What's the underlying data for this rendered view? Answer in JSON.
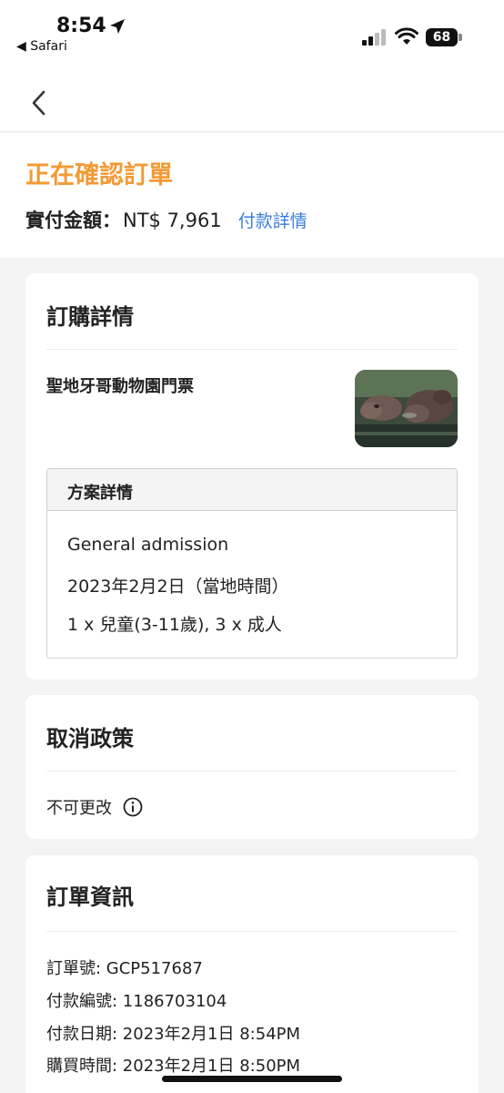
{
  "status_bar": {
    "time": "8:54",
    "back_app": "◀ Safari",
    "battery": "68"
  },
  "header": {
    "status_title": "正在確認訂單",
    "amount_label": "實付金額：",
    "amount_value": "NT$ 7,961",
    "payment_details_link": "付款詳情"
  },
  "booking": {
    "title": "訂購詳情",
    "product_name": "聖地牙哥動物園門票",
    "plan": {
      "header": "方案詳情",
      "name": "General admission",
      "date": "2023年2月2日（當地時間）",
      "quantity": "1 x 兒童(3-11歲), 3 x 成人"
    }
  },
  "cancellation": {
    "title": "取消政策",
    "policy": "不可更改"
  },
  "order_info": {
    "title": "訂單資訊",
    "order_no": "訂單號: GCP517687",
    "payment_no": "付款編號: 1186703104",
    "payment_date": "付款日期: 2023年2月1日 8:54PM",
    "purchase_time": "購買時間: 2023年2月1日 8:50PM"
  },
  "colors": {
    "accent_orange": "#f39a35",
    "link_blue": "#3a7ee0",
    "background": "#f3f3f3"
  },
  "icons": [
    "location-arrow-icon",
    "signal-icon",
    "wifi-icon",
    "battery-icon",
    "back-chevron-icon",
    "info-icon"
  ]
}
